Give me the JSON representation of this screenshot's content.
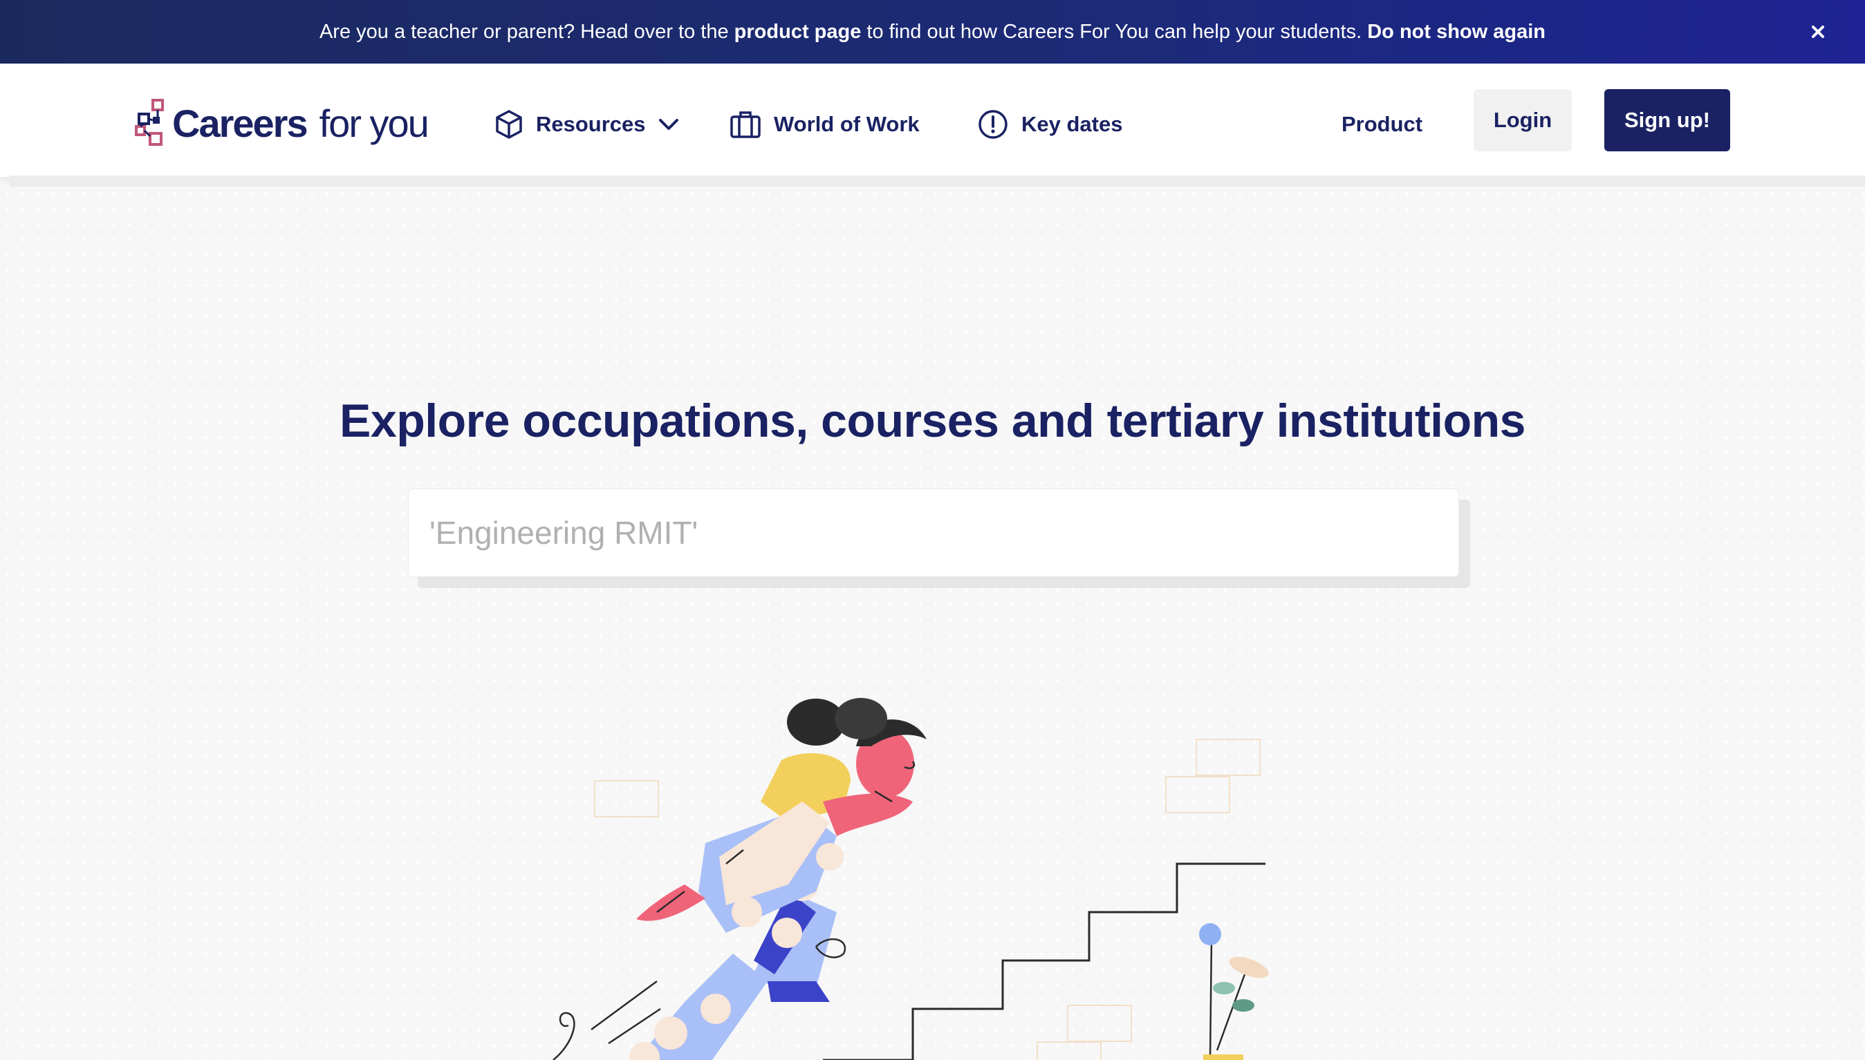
{
  "banner": {
    "text_1": "Are you a teacher or parent? Head over to the ",
    "link_label": "product page",
    "text_2": " to find out how Careers For You can help your students. ",
    "dismiss_label": "Do not show again",
    "close_icon": "close-icon"
  },
  "header": {
    "logo": {
      "text_bold": "Careers",
      "text_regular": "for you",
      "icon": "logo-mark-icon"
    },
    "nav": {
      "resources": {
        "label": "Resources",
        "icon": "cube-icon",
        "caret_icon": "chevron-down-icon"
      },
      "world_of_work": {
        "label": "World of Work",
        "icon": "briefcase-icon"
      },
      "key_dates": {
        "label": "Key dates",
        "icon": "exclamation-circle-icon"
      },
      "product": {
        "label": "Product"
      }
    },
    "login_label": "Login",
    "signup_label": "Sign up!"
  },
  "hero": {
    "title": "Explore occupations, courses and tertiary institutions",
    "search": {
      "placeholder": "'Engineering RMIT'",
      "value": ""
    }
  },
  "colors": {
    "brand_navy": "#1a2263",
    "banner_bg": "#1c2a78",
    "page_bg": "#f7f7f7",
    "logo_accent": "#c0567a"
  }
}
